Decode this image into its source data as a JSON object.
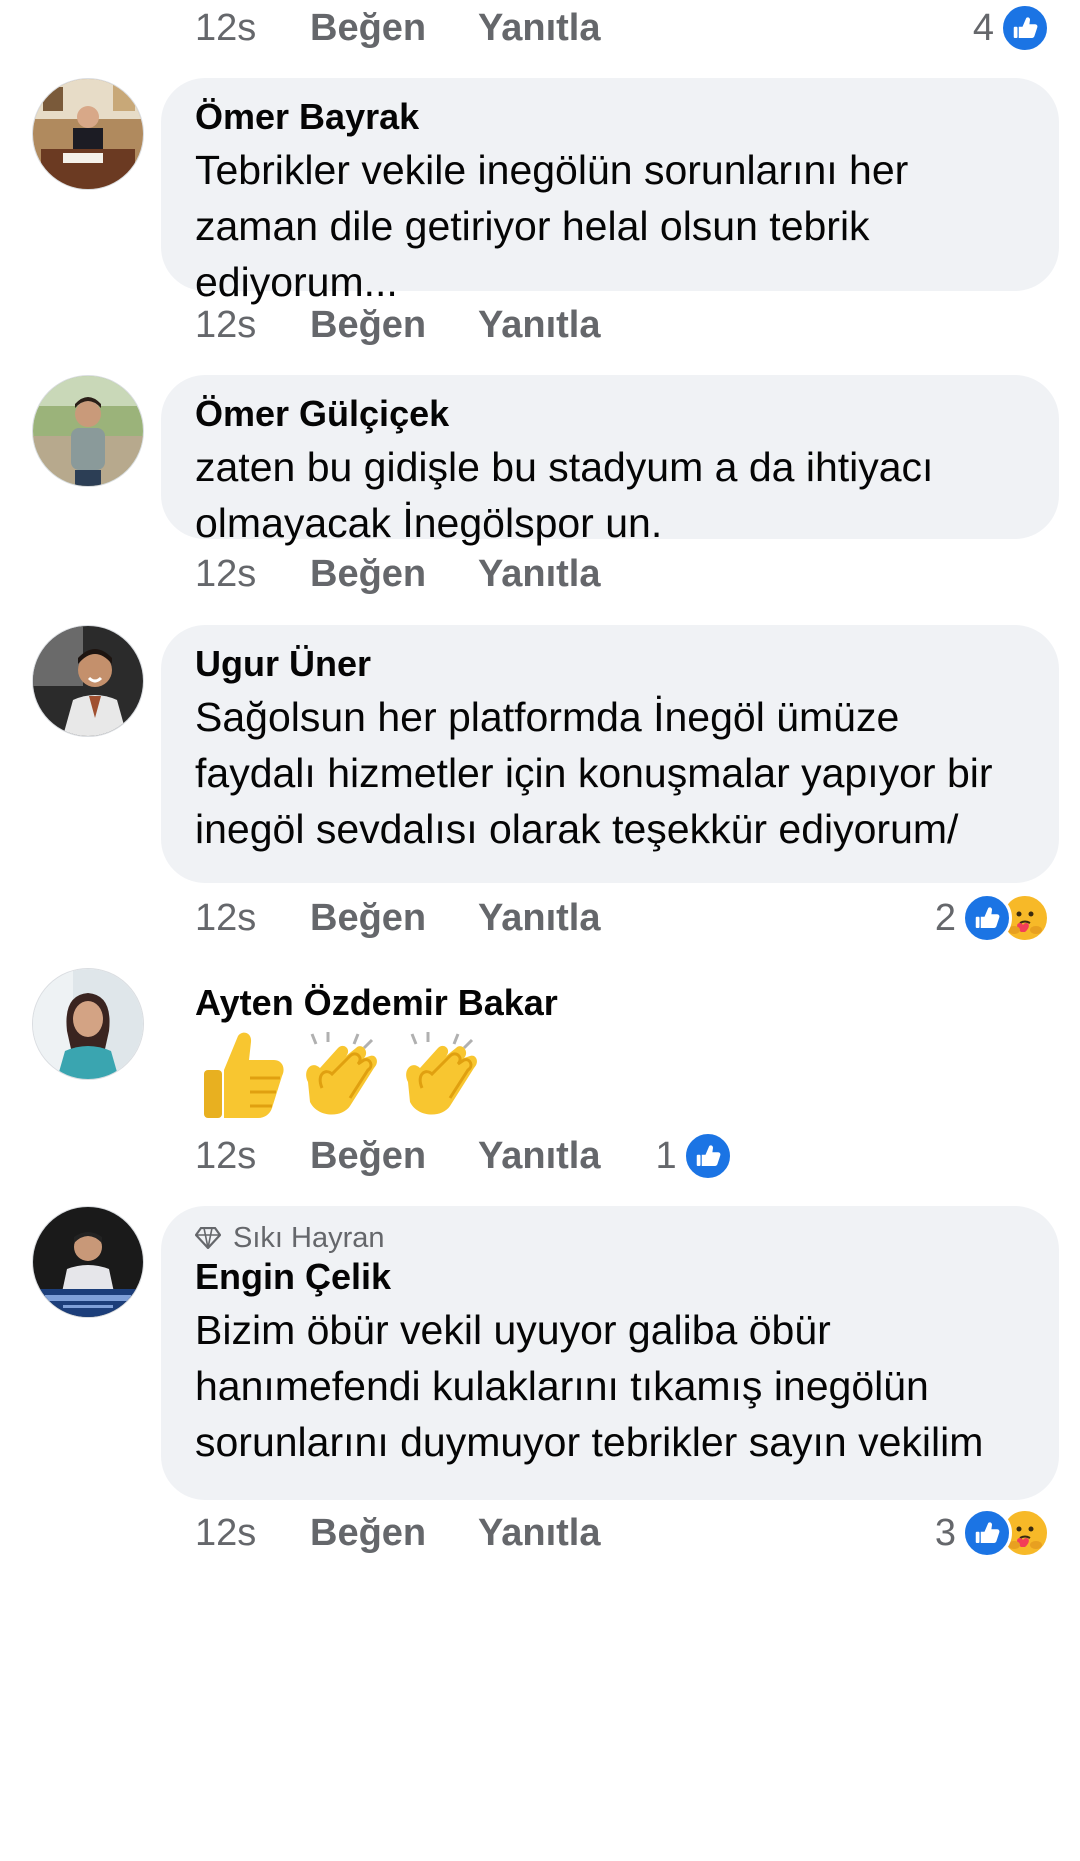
{
  "colors": {
    "bubble_bg": "#f0f2f5",
    "meta_text": "#65676b",
    "like_blue": "#1b74e4",
    "care_yellow": "#f7b928"
  },
  "top_row": {
    "time": "12s",
    "like_label": "Beğen",
    "reply_label": "Yanıtla",
    "reaction_count": "4",
    "reactions": [
      "like-icon"
    ]
  },
  "comments": [
    {
      "author": "Ömer Bayrak",
      "text": "Tebrikler vekile inegölün sorunlarını her zaman dile getiriyor helal olsun tebrik ediyorum...",
      "time": "12s",
      "like_label": "Beğen",
      "reply_label": "Yanıtla",
      "reaction_count": "",
      "avatar_icon": "office-person-avatar"
    },
    {
      "author": "Ömer Gülçiçek",
      "text": "zaten bu gidişle bu stadyum a da ihtiyacı olmayacak İnegölspor un.",
      "time": "12s",
      "like_label": "Beğen",
      "reply_label": "Yanıtla",
      "reaction_count": "",
      "avatar_icon": "man-outdoor-avatar"
    },
    {
      "author": "Ugur Üner",
      "text": "Sağolsun her platformda İnegöl ümüze faydalı hizmetler için konuşmalar yapıyor bir inegöl sevdalısı olarak teşekkür ediyorum/",
      "time": "12s",
      "like_label": "Beğen",
      "reply_label": "Yanıtla",
      "reaction_count": "2",
      "reactions": [
        "like-icon",
        "care-icon"
      ],
      "avatar_icon": "smiling-man-avatar"
    },
    {
      "author": "Ayten Özdemir Bakar",
      "emojis": [
        "thumbs-up-emoji",
        "clapping-hands-emoji",
        "clapping-hands-emoji"
      ],
      "time": "12s",
      "like_label": "Beğen",
      "reply_label": "Yanıtla",
      "reaction_count": "1",
      "reactions": [
        "like-icon"
      ],
      "avatar_icon": "woman-avatar"
    },
    {
      "badge": "Sıkı Hayran",
      "badge_icon": "diamond-icon",
      "author": "Engin Çelik",
      "text": "Bizim öbür vekil uyuyor galiba öbür hanımefendi kulaklarını tıkamış inegölün sorunlarını duymuyor tebrikler sayın vekilim",
      "time": "12s",
      "like_label": "Beğen",
      "reply_label": "Yanıtla",
      "reaction_count": "3",
      "reactions": [
        "like-icon",
        "care-icon"
      ],
      "avatar_icon": "man-stayhome-avatar"
    }
  ]
}
